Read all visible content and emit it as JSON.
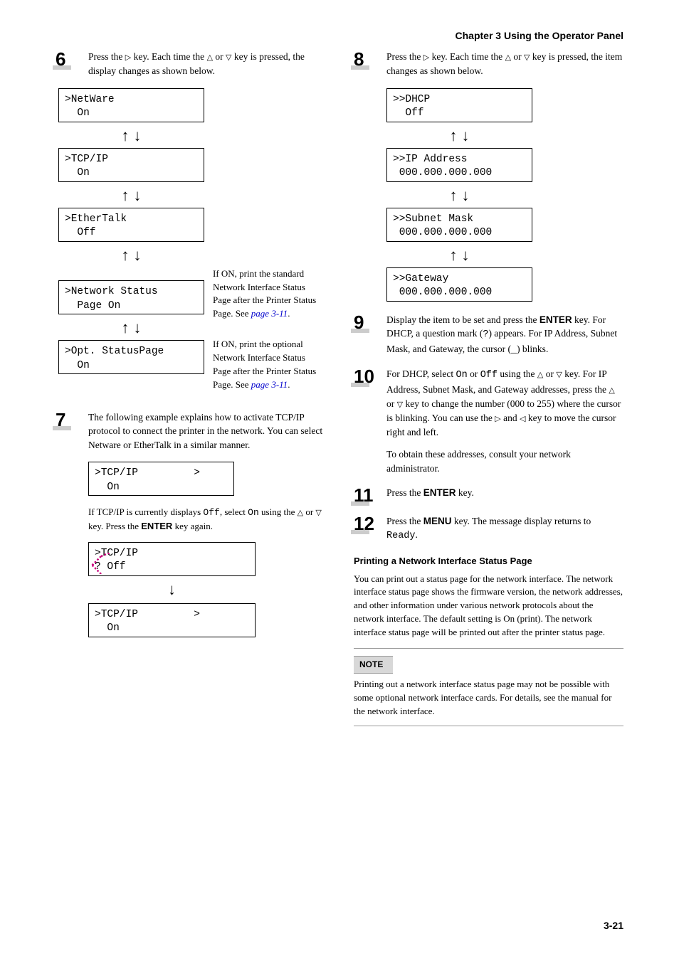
{
  "header": {
    "chapter": "Chapter 3  Using the Operator Panel"
  },
  "left": {
    "step6_text_a": "Press the ",
    "step6_text_b": " key. Each time the ",
    "step6_text_c": " or ",
    "step6_text_d": " key is pressed, the display changes as shown below.",
    "lcd_netware_1": ">NetWare",
    "lcd_netware_2": "  On",
    "lcd_tcp_1": ">TCP/IP",
    "lcd_tcp_2": "  On",
    "lcd_ether_1": ">EtherTalk",
    "lcd_ether_2": "  Off",
    "lcd_net_1": ">Network Status",
    "lcd_net_2": "  Page On",
    "lcd_opt_1": ">Opt. StatusPage",
    "lcd_opt_2": "  On",
    "side_net_a": "If ON, print the standard Network Interface Status Page after the Printer Status Page. See ",
    "side_net_link": "page 3-11",
    "side_dot": ".",
    "side_opt_a": "If ON, print the optional Network Interface Status Page after the Printer Status Page. See ",
    "side_opt_link": "page 3-11",
    "step7_text": "The following example explains how to activate TCP/IP protocol to connect the printer in the network. You can select Netware or EtherTalk in a similar manner.",
    "lcd7_1": ">TCP/IP         >",
    "lcd7_2": "  On",
    "tcp_off_a": "If TCP/IP is currently displays ",
    "tcp_off_b": ", select ",
    "tcp_off_c": " using the ",
    "tcp_off_d": " or ",
    "tcp_off_e": " key. Press the ",
    "tcp_off_f": " key again.",
    "off": "Off",
    "on": "On",
    "enter": "ENTER",
    "lcd7b_1": ">TCP/IP",
    "lcd7b_2": "? Off",
    "lcd7c_1": ">TCP/IP         >",
    "lcd7c_2": "  On"
  },
  "right": {
    "step8_a": "Press the ",
    "step8_b": " key. Each time the ",
    "step8_c": " or ",
    "step8_d": " key is pressed, the item changes as shown below.",
    "lcd_dhcp_1": ">>DHCP",
    "lcd_dhcp_2": "  Off",
    "lcd_ip_1": ">>IP Address",
    "lcd_ip_2": " 000.000.000.000",
    "lcd_sub_1": ">>Subnet Mask",
    "lcd_sub_2": " 000.000.000.000",
    "lcd_gw_1": ">>Gateway",
    "lcd_gw_2": " 000.000.000.000",
    "step9_a": "Display the item to be set and press the ",
    "step9_b": " key. For DHCP, a question mark (",
    "step9_c": ") appears. For IP Address, Subnet Mask, and Gateway, the cursor (",
    "step9_d": ") blinks.",
    "q": "?",
    "underscore": "_",
    "enter": "ENTER",
    "step10_a": "For DHCP, select ",
    "step10_b": " or ",
    "step10_c": " using the ",
    "step10_d": " or ",
    "step10_e": " key. For IP Address, Subnet Mask, and Gateway addresses, press the ",
    "step10_f": " or ",
    "step10_g": " key to change the number (000 to 255) where the cursor is blinking. You can use the ",
    "step10_h": " and ",
    "step10_i": " key to move the cursor right and left.",
    "on": "On",
    "off": "Off",
    "step10_note": "To obtain these addresses, consult your network administrator.",
    "step11_a": "Press the ",
    "step11_b": " key.",
    "step12_a": "Press the ",
    "step12_b": " key. The message display returns to ",
    "step12_c": ".",
    "menu": "MENU",
    "ready": "Ready",
    "section_heading": "Printing a Network Interface Status Page",
    "section_body": "You can print out a status page for the network interface. The network interface status page shows the firmware version, the network addresses, and other information under various network protocols about the network interface. The default setting is On (print). The network interface status page will be printed out after the printer status page.",
    "note_label": "NOTE",
    "note_body": "Printing out a network interface status page may not be possible with some optional network interface cards. For details, see the manual for the network interface."
  },
  "footer": {
    "page": "3-21"
  }
}
